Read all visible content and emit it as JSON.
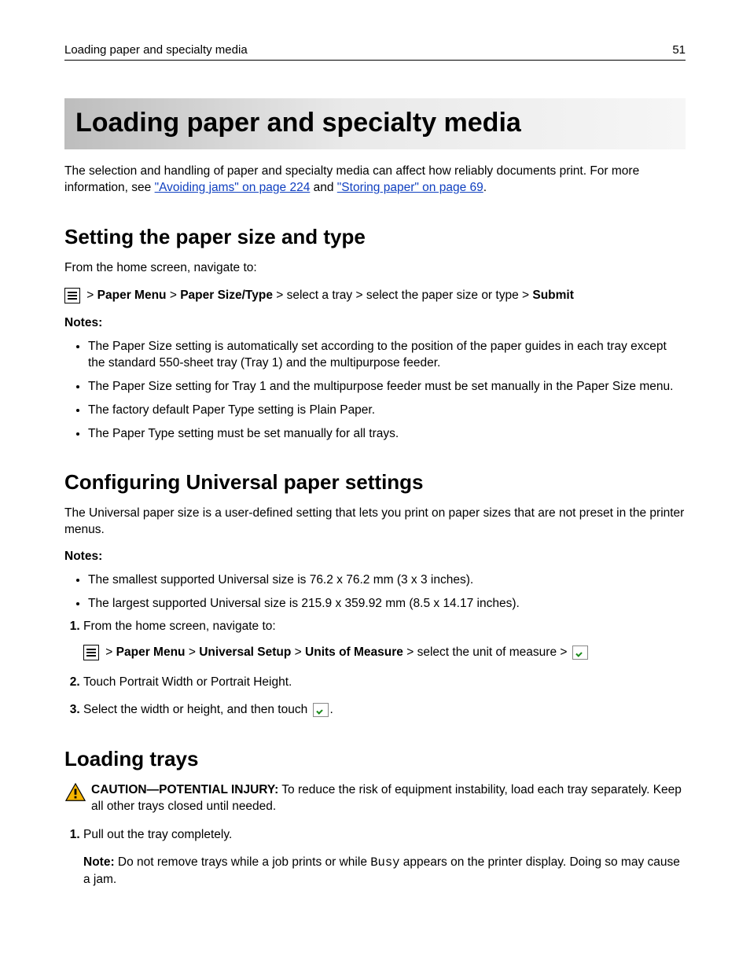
{
  "header": {
    "section": "Loading paper and specialty media",
    "page_number": "51"
  },
  "title": "Loading paper and specialty media",
  "intro": {
    "text_before": "The selection and handling of paper and specialty media can affect how reliably documents print. For more information, see ",
    "link1": "\"Avoiding jams\" on page 224",
    "text_mid": " and ",
    "link2": "\"Storing paper\" on page 69",
    "text_after": "."
  },
  "s1": {
    "heading": "Setting the paper size and type",
    "lead": "From the home screen, navigate to:",
    "nav": {
      "p1": "Paper Menu",
      "p2": "Paper Size/Type",
      "p3": "select a tray",
      "p4": "select the paper size or type",
      "p5": "Submit"
    },
    "notes_label": "Notes:",
    "notes": [
      "The Paper Size setting is automatically set according to the position of the paper guides in each tray except the standard 550‑sheet tray (Tray 1) and the multipurpose feeder.",
      "The Paper Size setting for Tray 1 and the multipurpose feeder must be set manually in the Paper Size menu.",
      "The factory default Paper Type setting is Plain Paper.",
      "The Paper Type setting must be set manually for all trays."
    ]
  },
  "s2": {
    "heading": "Configuring Universal paper settings",
    "lead": "The Universal paper size is a user‑defined setting that lets you print on paper sizes that are not preset in the printer menus.",
    "notes_label": "Notes:",
    "notes": [
      "The smallest supported Universal size is 76.2 x 76.2 mm (3 x 3 inches).",
      "The largest supported Universal size is 215.9 x 359.92 mm (8.5 x 14.17 inches)."
    ],
    "step1_lead": "From the home screen, navigate to:",
    "nav": {
      "p1": "Paper Menu",
      "p2": "Universal Setup",
      "p3": "Units of Measure",
      "p4": "select the unit of measure"
    },
    "step2_a": "Touch ",
    "step2_b1": "Portrait Width",
    "step2_or": " or ",
    "step2_b2": "Portrait Height",
    "step2_end": ".",
    "step3_a": "Select the width or height, and then touch ",
    "step3_end": "."
  },
  "s3": {
    "heading": "Loading trays",
    "caution_label": "CAUTION—POTENTIAL INJURY:",
    "caution_text": " To reduce the risk of equipment instability, load each tray separately. Keep all other trays closed until needed.",
    "step1": "Pull out the tray completely.",
    "note_label": "Note:",
    "note_a": " Do not remove trays while a job prints or while ",
    "note_busy": "Busy",
    "note_b": " appears on the printer display. Doing so may cause a jam."
  }
}
